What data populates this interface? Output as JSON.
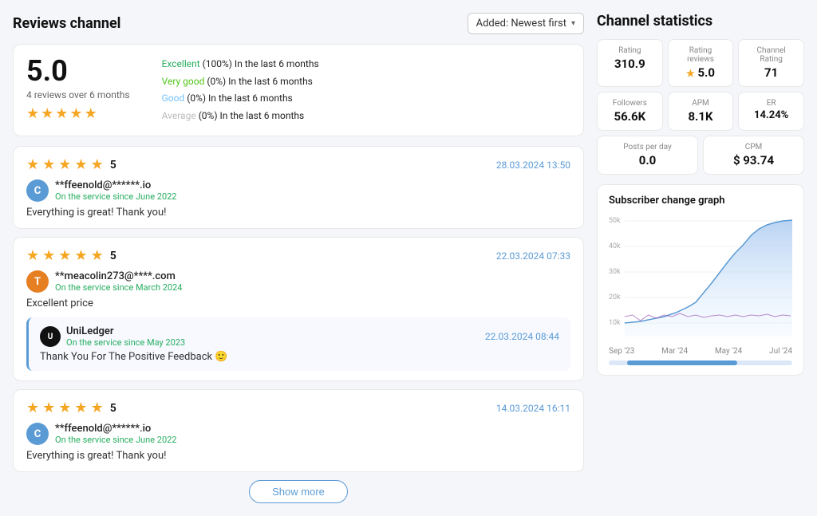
{
  "header": {
    "title": "Reviews channel",
    "sort_label": "Added: Newest first"
  },
  "summary": {
    "score": "5.0",
    "reviews_count": "4 reviews over 6 months",
    "stars": 5,
    "stats": [
      {
        "label": "Excellent",
        "pct": "100%",
        "period": "In the last 6 months",
        "class": "excellent"
      },
      {
        "label": "Very good",
        "pct": "0%",
        "period": "In the last 6 months",
        "class": "very-good"
      },
      {
        "label": "Good",
        "pct": "0%",
        "period": "In the last 6 months",
        "class": "good"
      },
      {
        "label": "Average",
        "pct": "0%",
        "period": "In the last 6 months",
        "class": "average"
      }
    ]
  },
  "reviews": [
    {
      "id": "r1",
      "score": "5",
      "date": "28.03.2024 13:50",
      "avatar_letter": "C",
      "avatar_class": "avatar-c",
      "username": "**ffeenold@******.io",
      "since": "On the service since June 2022",
      "text": "Everything is great! Thank you!",
      "reply": null
    },
    {
      "id": "r2",
      "score": "5",
      "date": "22.03.2024 07:33",
      "avatar_letter": "T",
      "avatar_class": "avatar-t",
      "username": "**meacolin273@****.com",
      "since": "On the service since March 2024",
      "text": "Excellent price",
      "reply": {
        "brand_letter": "U",
        "brand_name": "UniLedger",
        "brand_since": "On the service since May 2023",
        "date": "22.03.2024 08:44",
        "text": "Thank You For The Positive Feedback 🙂"
      }
    },
    {
      "id": "r3",
      "score": "5",
      "date": "14.03.2024 16:11",
      "avatar_letter": "C",
      "avatar_class": "avatar-c",
      "username": "**ffeenold@******.io",
      "since": "On the service since June 2022",
      "text": "Everything is great! Thank you!",
      "reply": null
    }
  ],
  "show_more_label": "Show more",
  "channel_stats": {
    "title": "Channel statistics",
    "boxes_row1": [
      {
        "label": "Rating",
        "value": "310.9"
      },
      {
        "label": "Rating reviews",
        "value": "5.0",
        "star": true
      },
      {
        "label": "Channel Rating",
        "value": "71"
      }
    ],
    "boxes_row2": [
      {
        "label": "Followers",
        "value": "56.6K"
      },
      {
        "label": "APM",
        "value": "8.1K"
      },
      {
        "label": "ER",
        "value": "14.24%"
      }
    ],
    "boxes_row3": [
      {
        "label": "Posts per day",
        "value": "0.0"
      },
      {
        "label": "CPM",
        "value": "$ 93.74"
      }
    ],
    "graph": {
      "title": "Subscriber change graph",
      "y_labels": [
        "50k",
        "40k",
        "30k",
        "20k",
        "10k"
      ],
      "x_labels": [
        "Sep '23",
        "Mar '24",
        "May '24",
        "Jul '24"
      ]
    }
  }
}
